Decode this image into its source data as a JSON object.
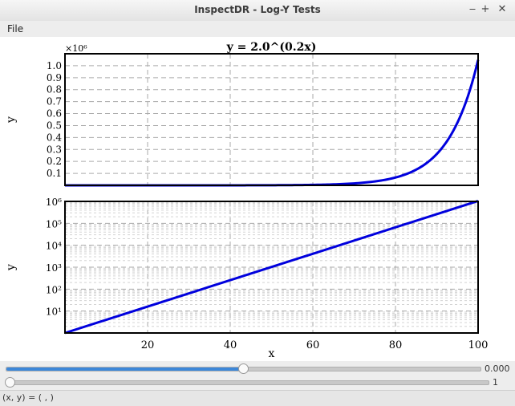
{
  "window": {
    "title": "InspectDR - Log-Y Tests",
    "minimize_glyph": "‒",
    "maximize_glyph": "+",
    "close_glyph": "✕"
  },
  "menu": {
    "file_label": "File"
  },
  "chart_data": [
    {
      "type": "line",
      "title": "y = 2.0^(0.2x)",
      "ylabel": "y",
      "yscale": "linear",
      "y_multiplier_label": "×10⁶",
      "xlim": [
        0,
        100
      ],
      "ylim": [
        0,
        1.1
      ],
      "yticks": [
        "0.1",
        "0.2",
        "0.3",
        "0.4",
        "0.5",
        "0.6",
        "0.7",
        "0.8",
        "0.9",
        "1.0"
      ],
      "grid": true,
      "series": [
        {
          "color": "#0000dd",
          "x": [
            0,
            10,
            20,
            30,
            40,
            50,
            60,
            70,
            75,
            80,
            85,
            90,
            95,
            100
          ],
          "y": [
            1e-06,
            4e-06,
            1.6e-05,
            6.4e-05,
            0.000256,
            0.001024,
            0.004096,
            0.016384,
            0.032768,
            0.065536,
            0.131072,
            0.262144,
            0.524288,
            1.048576
          ]
        }
      ]
    },
    {
      "type": "line",
      "xlabel": "x",
      "ylabel": "y",
      "yscale": "log",
      "xlim": [
        0,
        100
      ],
      "ylim": [
        1,
        1000000
      ],
      "xticks": [
        "20",
        "40",
        "60",
        "80",
        "100"
      ],
      "yticks": [
        "10¹",
        "10²",
        "10³",
        "10⁴",
        "10⁵",
        "10⁶"
      ],
      "grid": true,
      "series": [
        {
          "color": "#0000dd",
          "x": [
            0,
            100
          ],
          "y": [
            1,
            1048576
          ]
        }
      ]
    }
  ],
  "controls": {
    "slider1_value": "0.000",
    "slider1_fraction": 0.5,
    "slider2_value": "1",
    "slider2_fraction": 0
  },
  "status": {
    "text": "(x, y) = ( , )"
  }
}
